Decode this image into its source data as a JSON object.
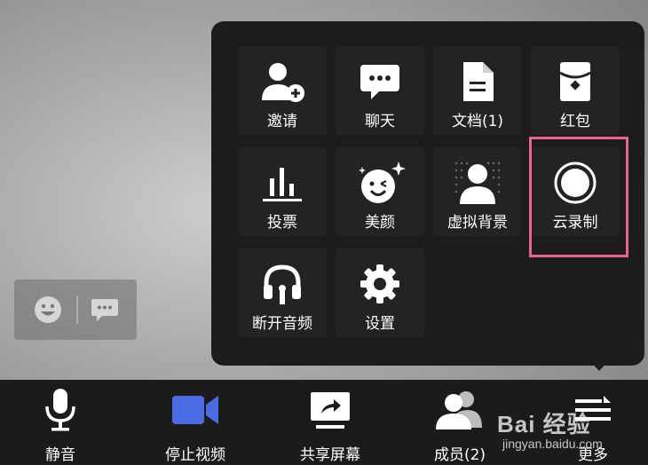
{
  "panel": {
    "row1": [
      {
        "label": "邀请",
        "icon": "add-user-icon"
      },
      {
        "label": "聊天",
        "icon": "chat-icon"
      },
      {
        "label": "文档(1)",
        "icon": "document-icon"
      },
      {
        "label": "红包",
        "icon": "red-packet-icon"
      }
    ],
    "row2": [
      {
        "label": "投票",
        "icon": "vote-icon"
      },
      {
        "label": "美颜",
        "icon": "beauty-face-icon"
      },
      {
        "label": "虚拟背景",
        "icon": "virtual-background-icon"
      },
      {
        "label": "云录制",
        "icon": "cloud-record-icon"
      }
    ],
    "row3": [
      {
        "label": "断开音频",
        "icon": "headphone-icon"
      },
      {
        "label": "设置",
        "icon": "gear-icon"
      }
    ]
  },
  "toolbar": {
    "mute": {
      "label": "静音",
      "icon": "microphone-icon"
    },
    "stop_video": {
      "label": "停止视频",
      "icon": "video-camera-icon",
      "color": "#4a6de5"
    },
    "share_screen": {
      "label": "共享屏幕",
      "icon": "share-screen-icon"
    },
    "members": {
      "label": "成员(2)",
      "icon": "members-icon"
    },
    "more": {
      "label": "更多",
      "icon": "more-icon"
    }
  },
  "floating_bar": {
    "emoji_icon": "emoji-icon",
    "chat_icon": "chat-bubble-icon"
  },
  "watermark": {
    "top": "Bai 经验",
    "bottom": "jingyan.baidu.com"
  },
  "highlight_color": "#e8648f"
}
